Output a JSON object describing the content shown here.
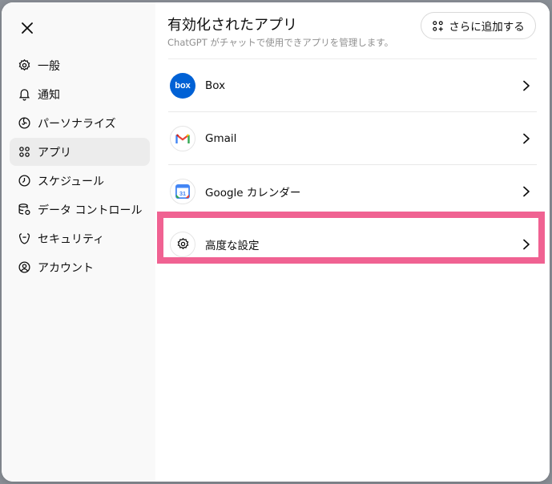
{
  "sidebar": {
    "close_icon": "close-icon",
    "items": [
      {
        "label": "一般",
        "icon": "gear-icon"
      },
      {
        "label": "通知",
        "icon": "bell-icon"
      },
      {
        "label": "パーソナライズ",
        "icon": "personalize-icon"
      },
      {
        "label": "アプリ",
        "icon": "apps-grid-icon",
        "active": true
      },
      {
        "label": "スケジュール",
        "icon": "clock-icon"
      },
      {
        "label": "データ コントロール",
        "icon": "database-icon"
      },
      {
        "label": "セキュリティ",
        "icon": "shield-icon"
      },
      {
        "label": "アカウント",
        "icon": "account-icon"
      }
    ]
  },
  "main": {
    "title": "有効化されたアプリ",
    "subtitle": "ChatGPT がチャットで使用できアプリを管理します。",
    "add_button_label": "さらに追加する",
    "apps": [
      {
        "label": "Box",
        "icon": "box-logo-icon"
      },
      {
        "label": "Gmail",
        "icon": "gmail-logo-icon"
      },
      {
        "label": "Google カレンダー",
        "icon": "google-calendar-icon"
      },
      {
        "label": "高度な設定",
        "icon": "gear-icon"
      }
    ]
  },
  "colors": {
    "highlight": "#f06292",
    "box_blue": "#0061d5",
    "sidebar_bg": "#f9f9f9",
    "active_bg": "#ececec"
  }
}
